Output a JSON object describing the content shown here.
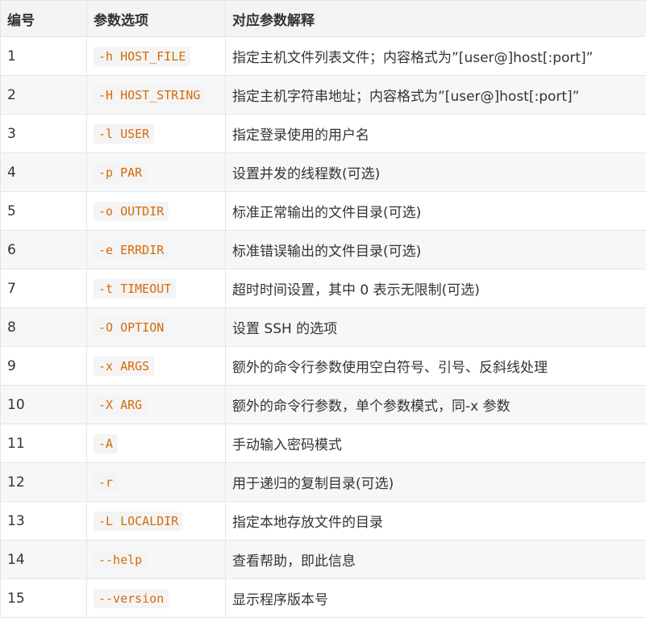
{
  "table": {
    "headers": [
      "编号",
      "参数选项",
      "对应参数解释"
    ],
    "rows": [
      {
        "num": "1",
        "option": "-h HOST_FILE",
        "desc": "指定主机文件列表文件；内容格式为”[user@]host[:port]”"
      },
      {
        "num": "2",
        "option": "-H HOST_STRING",
        "desc": "指定主机字符串地址；内容格式为”[user@]host[:port]”"
      },
      {
        "num": "3",
        "option": "-l USER",
        "desc": "指定登录使用的用户名"
      },
      {
        "num": "4",
        "option": "-p PAR",
        "desc": "设置并发的线程数(可选)"
      },
      {
        "num": "5",
        "option": "-o OUTDIR",
        "desc": "标准正常输出的文件目录(可选)"
      },
      {
        "num": "6",
        "option": "-e ERRDIR",
        "desc": "标准错误输出的文件目录(可选)"
      },
      {
        "num": "7",
        "option": "-t TIMEOUT",
        "desc": "超时时间设置，其中 0 表示无限制(可选)"
      },
      {
        "num": "8",
        "option": "-O OPTION",
        "desc": "设置 SSH 的选项"
      },
      {
        "num": "9",
        "option": "-x ARGS",
        "desc": "额外的命令行参数使用空白符号、引号、反斜线处理"
      },
      {
        "num": "10",
        "option": "-X ARG",
        "desc": "额外的命令行参数，单个参数模式，同-x 参数"
      },
      {
        "num": "11",
        "option": "-A",
        "desc": "手动输入密码模式"
      },
      {
        "num": "12",
        "option": "-r",
        "desc": "用于递归的复制目录(可选)"
      },
      {
        "num": "13",
        "option": "-L LOCALDIR",
        "desc": "指定本地存放文件的目录"
      },
      {
        "num": "14",
        "option": "--help",
        "desc": "查看帮助，即此信息"
      },
      {
        "num": "15",
        "option": "--version",
        "desc": "显示程序版本号"
      }
    ]
  },
  "colors": {
    "option_text": "#d46b08",
    "option_bg": "#f4f4f5",
    "header_bg": "#f3f4f6",
    "stripe_bg": "#f6f7f8",
    "border": "#e3e5e8"
  }
}
